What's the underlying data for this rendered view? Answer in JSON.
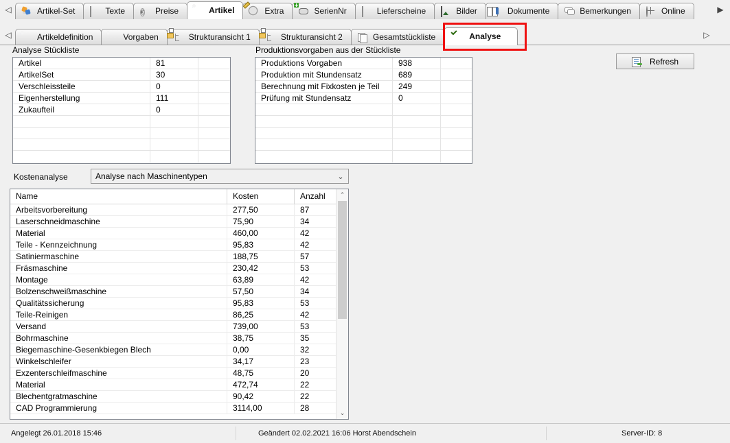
{
  "top_tabs": {
    "nav_left": "◁",
    "nav_right": "▶",
    "items": [
      {
        "label": "Artikel-Set",
        "icon": "artikel-set-icon",
        "active": false
      },
      {
        "label": "Texte",
        "icon": "text-lines-icon",
        "active": false
      },
      {
        "label": "Preise",
        "icon": "euro-icon",
        "active": false
      },
      {
        "label": "Artikel",
        "icon": "gear-blue-icon",
        "active": true
      },
      {
        "label": "Extra",
        "icon": "gear-pencil-icon",
        "active": false
      },
      {
        "label": "SerienNr",
        "icon": "serial-number-icon",
        "active": false
      },
      {
        "label": "Lieferscheine",
        "icon": "document-icon",
        "active": false
      },
      {
        "label": "Bilder",
        "icon": "image-icon",
        "active": false
      },
      {
        "label": "Dokumente",
        "icon": "book-icon",
        "active": false
      },
      {
        "label": "Bemerkungen",
        "icon": "comment-bubble-icon",
        "active": false
      },
      {
        "label": "Online",
        "icon": "globe-icon",
        "active": false
      }
    ]
  },
  "sub_tabs": {
    "nav_left": "◁",
    "nav_right": "▷",
    "items": [
      {
        "label": "Artikeldefinition",
        "icon": "gear-blue-icon",
        "active": false
      },
      {
        "label": "Vorgaben",
        "icon": "gear-grey-icon",
        "active": false
      },
      {
        "label": "Strukturansicht 1",
        "icon": "tree-folder-icon",
        "active": false
      },
      {
        "label": "Strukturansicht 2",
        "icon": "tree-folder-icon",
        "active": false
      },
      {
        "label": "Gesamtstückliste",
        "icon": "stacked-pages-icon",
        "active": false
      },
      {
        "label": "Analyse",
        "icon": "gear-green-check-icon",
        "active": true
      }
    ]
  },
  "panels": {
    "left": {
      "title": "Analyse Stückliste",
      "rows": [
        {
          "label": "Artikel",
          "value": "81"
        },
        {
          "label": "ArtikelSet",
          "value": "30"
        },
        {
          "label": "Verschleissteile",
          "value": "0"
        },
        {
          "label": "Eigenherstellung",
          "value": "111"
        },
        {
          "label": "Zukaufteil",
          "value": "0"
        },
        {
          "label": "",
          "value": ""
        },
        {
          "label": "",
          "value": ""
        },
        {
          "label": "",
          "value": ""
        },
        {
          "label": "",
          "value": ""
        }
      ]
    },
    "right": {
      "title": "Produktionsvorgaben aus der Stückliste",
      "rows": [
        {
          "label": "Produktions Vorgaben",
          "value": "938"
        },
        {
          "label": "Produktion mit Stundensatz",
          "value": "689"
        },
        {
          "label": "Berechnung mit Fixkosten je Teil",
          "value": "249"
        },
        {
          "label": "Prüfung mit Stundensatz",
          "value": "0"
        },
        {
          "label": "",
          "value": ""
        },
        {
          "label": "",
          "value": ""
        },
        {
          "label": "",
          "value": ""
        },
        {
          "label": "",
          "value": ""
        },
        {
          "label": "",
          "value": ""
        }
      ]
    }
  },
  "refresh_button": {
    "label": "Refresh",
    "icon": "refresh-icon"
  },
  "kostenanalyse": {
    "label": "Kostenanalyse",
    "selected": "Analyse nach Maschinentypen",
    "arrow": "⌄"
  },
  "table": {
    "columns": [
      "Name",
      "Kosten",
      "Anzahl"
    ],
    "rows": [
      {
        "name": "Arbeitsvorbereitung",
        "kosten": "277,50",
        "anzahl": "87"
      },
      {
        "name": "Laserschneidmaschine",
        "kosten": "75,90",
        "anzahl": "34"
      },
      {
        "name": "Material",
        "kosten": "460,00",
        "anzahl": "42"
      },
      {
        "name": "Teile - Kennzeichnung",
        "kosten": "95,83",
        "anzahl": "42"
      },
      {
        "name": "Satiniermaschine",
        "kosten": "188,75",
        "anzahl": "57"
      },
      {
        "name": "Fräsmaschine",
        "kosten": "230,42",
        "anzahl": "53"
      },
      {
        "name": "Montage",
        "kosten": "63,89",
        "anzahl": "42"
      },
      {
        "name": "Bolzenschweißmaschine",
        "kosten": "57,50",
        "anzahl": "34"
      },
      {
        "name": "Qualitätssicherung",
        "kosten": "95,83",
        "anzahl": "53"
      },
      {
        "name": "Teile-Reinigen",
        "kosten": "86,25",
        "anzahl": "42"
      },
      {
        "name": "Versand",
        "kosten": "739,00",
        "anzahl": "53"
      },
      {
        "name": "Bohrmaschine",
        "kosten": "38,75",
        "anzahl": "35"
      },
      {
        "name": "Biegemaschine-Gesenkbiegen Blech",
        "kosten": "0,00",
        "anzahl": "32"
      },
      {
        "name": "Winkelschleifer",
        "kosten": "34,17",
        "anzahl": "23"
      },
      {
        "name": "Exzenterschleifmaschine",
        "kosten": "48,75",
        "anzahl": "20"
      },
      {
        "name": "Material",
        "kosten": "472,74",
        "anzahl": "22"
      },
      {
        "name": "Blechentgratmaschine",
        "kosten": "90,42",
        "anzahl": "22"
      },
      {
        "name": "CAD Programmierung",
        "kosten": "3114,00",
        "anzahl": "28"
      }
    ],
    "scroll_up": "⌃",
    "scroll_down": "⌄"
  },
  "status_bar": {
    "created": "Angelegt  26.01.2018  15:46",
    "changed": "Geändert  02.02.2021  16:06 Horst Abendschein",
    "server": "Server-ID:  8"
  },
  "colors": {
    "highlight": "#ef1111",
    "window_bg": "#f0f0f0",
    "border": "#828790",
    "accent_blue": "#2f8fd8",
    "accent_green": "#6fbf3c"
  }
}
